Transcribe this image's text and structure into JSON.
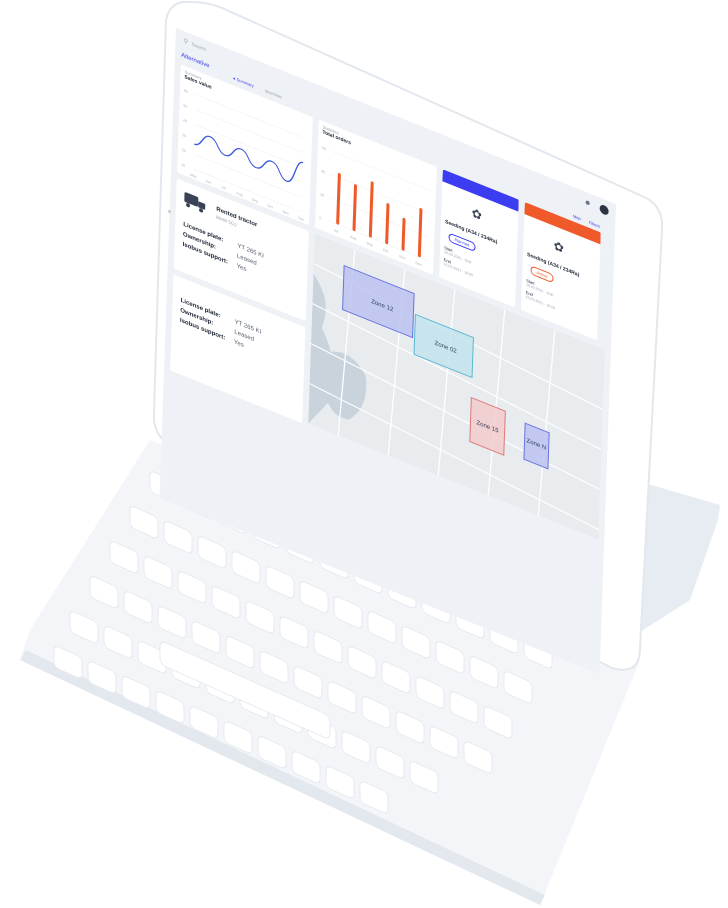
{
  "search": {
    "placeholder": "Search"
  },
  "header": {
    "title": "Alternative",
    "tabs": [
      "Summary",
      "Machines"
    ]
  },
  "sales_chart": {
    "overline": "Summary",
    "title": "Sales value",
    "chart_data": {
      "type": "line",
      "x": [
        "May",
        "Jun",
        "Jul",
        "Aug",
        "Sep",
        "Oct",
        "Nov",
        "Dec"
      ],
      "y_ticks": [
        "60",
        "50",
        "40",
        "30",
        "20",
        "10"
      ],
      "series": [
        {
          "values": [
            20,
            31,
            21,
            31,
            21,
            31,
            20,
            40
          ]
        }
      ]
    }
  },
  "orders_chart": {
    "overline": "Statistics",
    "title": "Total orders",
    "chart_data": {
      "type": "bar",
      "categories": [
        "Jul",
        "Aug",
        "Sep",
        "Oct",
        "Nov",
        "Dec"
      ],
      "y_ticks": [
        "60",
        "40",
        "20",
        "0"
      ],
      "values": [
        44,
        40,
        48,
        35,
        28,
        42
      ]
    }
  },
  "tractor": {
    "name": "Rented tractor",
    "model": "BMW 5G2",
    "rows": [
      {
        "label": "License plate:",
        "value": "YT 265 KI"
      },
      {
        "label": "Ownership:",
        "value": "Leased"
      },
      {
        "label": "Isobus support:",
        "value": "Yes"
      }
    ]
  },
  "machine2": {
    "rows": [
      {
        "label": "License plate:",
        "value": "YT 265 KI"
      },
      {
        "label": "Ownership:",
        "value": "Leased"
      },
      {
        "label": "Isobus support:",
        "value": "Yes"
      }
    ]
  },
  "seeding_cards": [
    {
      "title": "Seeding (A34 / 234Ra)",
      "pill": "Planned",
      "start_label": "Start",
      "start_value": "15.03.2021 · 9:00",
      "end_label": "End",
      "end_value": "15.03.2021 · 18:00",
      "color": "#3c3cf0"
    },
    {
      "title": "Seeding (A34 / 234Ra)",
      "pill": "Active",
      "start_label": "Start",
      "start_value": "15.03.2021 · 9:00",
      "end_label": "End",
      "end_value": "15.03.2021 · 18:00",
      "color": "#f05a2a"
    }
  ],
  "top_right_links": [
    "Map",
    "Filters"
  ],
  "map": {
    "zones": [
      "Zone 12",
      "Zone 02",
      "Zone 15",
      "Zone N"
    ]
  },
  "colors": {
    "accent": "#3c3cf0",
    "bar": "#f05a2a",
    "line": "#3c5ad8"
  }
}
